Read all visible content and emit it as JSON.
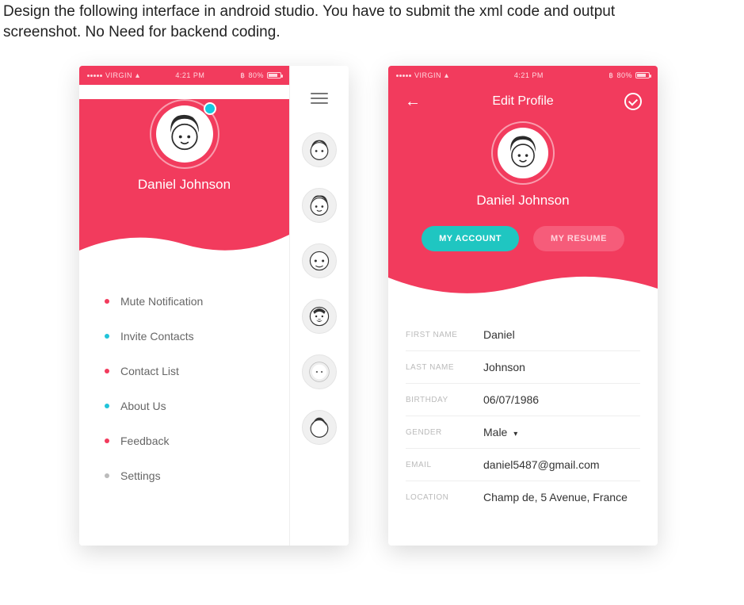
{
  "instruction_line1": "Design the following interface in android studio. You have to submit the xml code and output",
  "instruction_line2": "screenshot. No Need for backend coding.",
  "status": {
    "carrier": "VIRGIN",
    "time": "4:21 PM",
    "battery_pct": "80%"
  },
  "left_screen": {
    "username": "Daniel Johnson",
    "menu": [
      {
        "label": "Mute Notification",
        "bullet": "pink"
      },
      {
        "label": "Invite Contacts",
        "bullet": "cyan"
      },
      {
        "label": "Contact List",
        "bullet": "pink"
      },
      {
        "label": "About Us",
        "bullet": "cyan"
      },
      {
        "label": "Feedback",
        "bullet": "pink"
      },
      {
        "label": "Settings",
        "bullet": "grey"
      }
    ]
  },
  "right_screen": {
    "title": "Edit Profile",
    "username": "Daniel Johnson",
    "tabs": {
      "account": "MY ACCOUNT",
      "resume": "MY RESUME"
    },
    "fields": [
      {
        "label": "FIRST NAME",
        "value": "Daniel"
      },
      {
        "label": "LAST NAME",
        "value": "Johnson"
      },
      {
        "label": "BIRTHDAY",
        "value": "06/07/1986"
      },
      {
        "label": "GENDER",
        "value": "Male",
        "dropdown": true
      },
      {
        "label": "EMAIL",
        "value": "daniel5487@gmail.com"
      },
      {
        "label": "LOCATION",
        "value": "Champ de, 5 Avenue, France"
      }
    ]
  },
  "colors": {
    "pink": "#f23b5d",
    "teal": "#1fc6c1",
    "cyan": "#15c8e0"
  }
}
